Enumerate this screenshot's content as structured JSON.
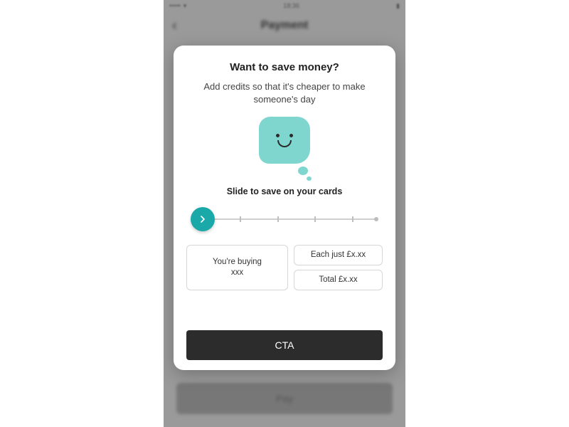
{
  "statusbar": {
    "time": "18:36",
    "carrier": "•••••",
    "wifi": "wifi",
    "battery": "batt"
  },
  "nav": {
    "title": "Payment",
    "back_glyph": "‹"
  },
  "bg_button": {
    "label": "Pay"
  },
  "modal": {
    "title": "Want to save money?",
    "subtitle": "Add credits so that it's cheaper to make someone's day",
    "slider_label": "Slide to save on your cards",
    "buying_label": "You're buying",
    "buying_value": "xxx",
    "each_label": "Each just £x.xx",
    "total_label": "Total £x.xx",
    "cta_label": "CTA"
  },
  "slider": {
    "steps": 6,
    "position": 0
  }
}
